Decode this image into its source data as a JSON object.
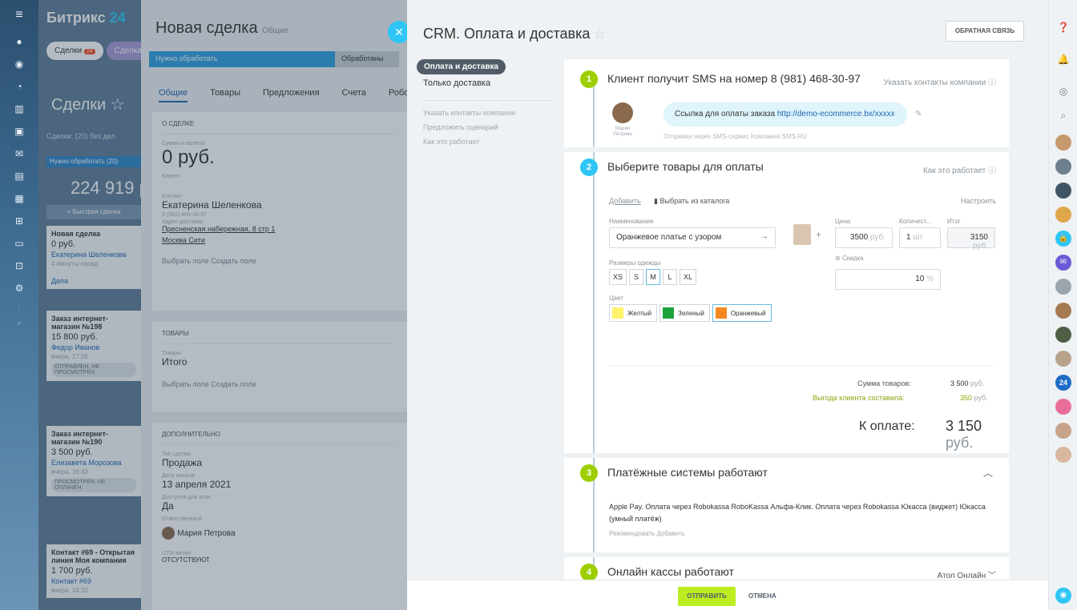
{
  "bg_crm": {
    "brand_name": "Битрикс",
    "brand_num": "24",
    "tab_deals": "Сделки",
    "tab_deals_badge": "24",
    "tab_deal2": "Сделка",
    "title": "Сделки ☆",
    "filter": "Сделки: (20) без дел",
    "stage": "Нужно обработать (20)",
    "sum": "224 919 р",
    "quick_add": "+ Быстрая сделка",
    "cards": [
      {
        "title": "Новая сделка",
        "sum": "0 руб.",
        "person": "Екатерина Шеленкова",
        "time": "4 минуты назад",
        "badge": "Дела"
      },
      {
        "title": "Заказ интернет-магазин №198",
        "sum": "15 800 руб.",
        "person": "Федор Иванов",
        "time": "вчера, 17:26",
        "badge": "ОТПРАВЛЕН, НЕ ПРОСМОТРЕН"
      },
      {
        "title": "Заказ интернет-магазин №190",
        "sum": "3 500 руб.",
        "person": "Елизавета Морозова",
        "time": "вчера, 16:43",
        "badge": "ПРОСМОТРЕН, НЕ ОПЛАЧЕН"
      },
      {
        "title": "Контакт #69 - Открытая линия Моя компания",
        "sum": "1 700 руб.",
        "person": "Контакт #69",
        "time": "вчера, 14:32",
        "badge": ""
      }
    ]
  },
  "deal": {
    "title": "Новая сделка",
    "subtitle": "Общие",
    "stage1": "Нужно обработать",
    "stage2": "Обработаны",
    "tabs": [
      "Общие",
      "Товары",
      "Предложения",
      "Счета",
      "Роботы"
    ],
    "about_header": "О СДЕЛКЕ",
    "sum_label": "Сумма и валюта",
    "sum_value": "0 руб.",
    "client_label": "Клиент",
    "contact_label": "Контакт",
    "contact_name": "Екатерина Шеленкова",
    "contact_phone": "8 (981) 468-30-97",
    "address_label": "Адрес доставки",
    "address": "Пресненская набережная, 8 стр 1",
    "address2": "Москва Сити",
    "field_links": "Выбрать поле   Создать поле",
    "goods_header": "ТОВАРЫ",
    "goods_label": "Товары",
    "goods_total": "Итого",
    "extra_header": "ДОПОЛНИТЕЛЬНО",
    "type_label": "Тип сделки",
    "type_value": "Продажа",
    "date_label": "Дата начала",
    "date_value": "13 апреля 2021",
    "avail_label": "Доступна для всех",
    "avail_value": "Да",
    "resp_label": "Ответственный",
    "resp_value": "Мария Петрова",
    "utm_label": "UTM метки",
    "utm_value": "ОТСУТСТВУЮТ"
  },
  "slider": {
    "title": "CRM. Оплата и доставка",
    "feedback": "ОБРАТНАЯ СВЯЗЬ",
    "menu": {
      "active": "Оплата и доставка",
      "item2": "Только доставка",
      "muted": [
        "Указать контакты компании",
        "Предложить сценарий",
        "Как это работает"
      ]
    },
    "step1": {
      "num": "1",
      "title": "Клиент получит SMS на номер 8 (981) 468-30-97",
      "link": "Указать контакты компании ⓘ",
      "avatar_name": "Мария Петрова",
      "bubble_text": "Ссылка для оплаты заказа ",
      "bubble_url": "http://demo-ecommerce.bx/xxxxx",
      "sub": "Отправка через SMS-сервис Компания SMS.RU"
    },
    "step2": {
      "num": "2",
      "title": "Выберите товары для оплаты",
      "link": "Как это работает ⓘ",
      "add": "Добавить",
      "catalog": "Выбрать из каталога",
      "settings": "Настроить",
      "name_label": "Наименование",
      "name_value": "Оранжевое платье с узором",
      "price_label": "Цена",
      "price_value": "3500",
      "price_unit": "руб.",
      "qty_label": "Количест...",
      "qty_value": "1",
      "qty_unit": "шт",
      "total_label": "Итог",
      "total_value": "3150",
      "total_unit": "руб.",
      "discount_label": "Скидка",
      "discount_value": "10",
      "discount_unit": "%",
      "sizes_label": "Размеры одежды",
      "sizes": [
        "XS",
        "S",
        "M",
        "L",
        "XL"
      ],
      "color_label": "Цвет",
      "colors": [
        {
          "name": "Желтый",
          "hex": "#fff36b"
        },
        {
          "name": "Зеленый",
          "hex": "#1aa33a"
        },
        {
          "name": "Оранжевый",
          "hex": "#f5891f"
        }
      ],
      "goods_sum_label": "Сумма товаров:",
      "goods_sum_value": "3 500",
      "benefit_label": "Выгода клиента составила:",
      "benefit_value": "350",
      "cur": "руб.",
      "topay_label": "К оплате:",
      "topay_value": "3 150",
      "topay_cur": "руб."
    },
    "step3": {
      "num": "3",
      "title": "Платёжные системы работают",
      "list": "Apple Pay. Оплата через Robokassa  RoboKassa  Альфа-Клик. Оплата через Robokassa  Юкасса (виджет)  Юкасса (умный платёж)",
      "actions": "Рекомендовать   Добавить"
    },
    "step4": {
      "num": "4",
      "title": "Онлайн кассы работают",
      "link": "Атол Онлайн"
    }
  },
  "footer": {
    "send": "ОТПРАВИТЬ",
    "cancel": "ОТМЕНА"
  },
  "colors": {
    "accent_green": "#9dcf00",
    "accent_blue": "#2fc6f6",
    "send_button": "#bbed21"
  }
}
